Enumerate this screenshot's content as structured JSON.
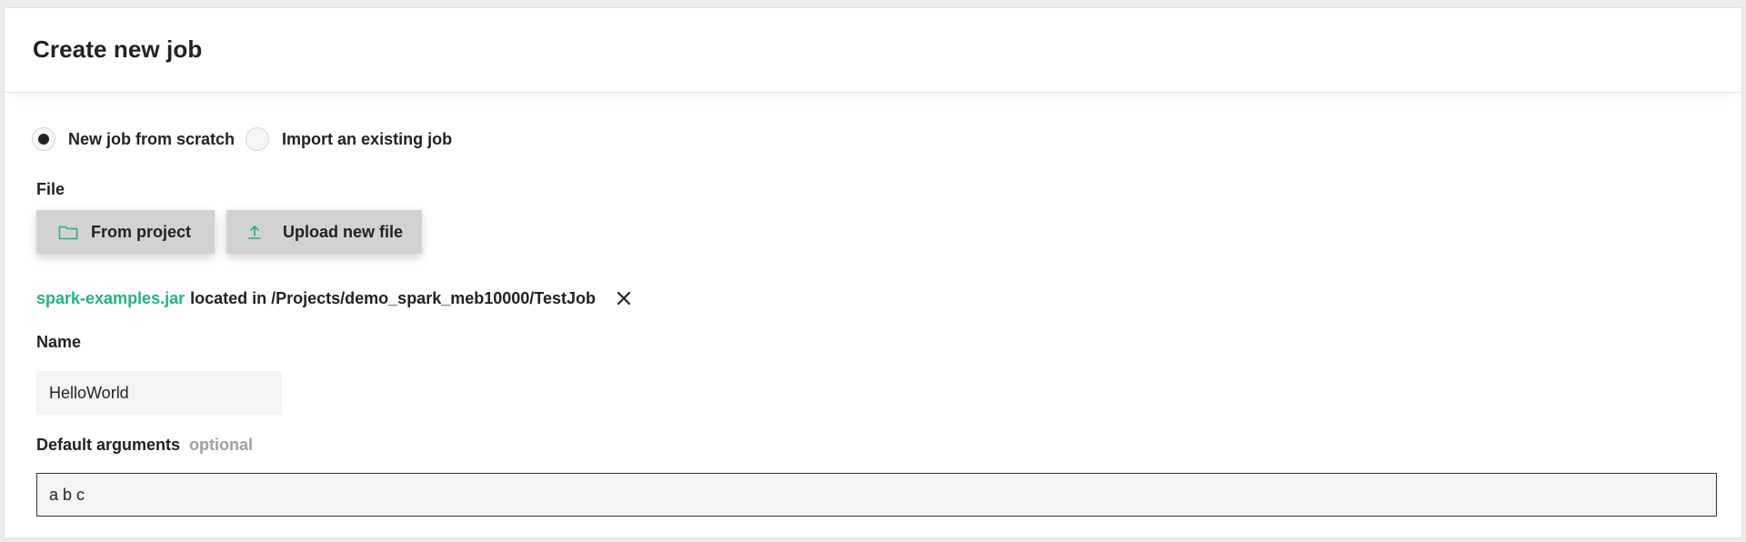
{
  "header": {
    "title": "Create new job"
  },
  "source_options": {
    "selected": "New job from scratch",
    "items": [
      {
        "label": "New job from scratch"
      },
      {
        "label": "Import an existing job"
      }
    ]
  },
  "file": {
    "label": "File",
    "from_project_label": "From project",
    "upload_label": "Upload new file",
    "selected_file": "spark-examples.jar",
    "location_text": "located in /Projects/demo_spark_meb10000/TestJob"
  },
  "name": {
    "label": "Name",
    "value": "HelloWorld"
  },
  "default_arguments": {
    "label": "Default arguments",
    "optional_tag": "optional",
    "value": "a b c"
  },
  "colors": {
    "accent": "#21b37e",
    "button_bg": "#d2d2d2",
    "input_bg": "#f4f4f4",
    "text": "#222222",
    "muted": "#a0a0a0"
  },
  "icons": {
    "from_project": "folder-icon",
    "upload": "upload-icon",
    "remove_file": "close-icon"
  }
}
